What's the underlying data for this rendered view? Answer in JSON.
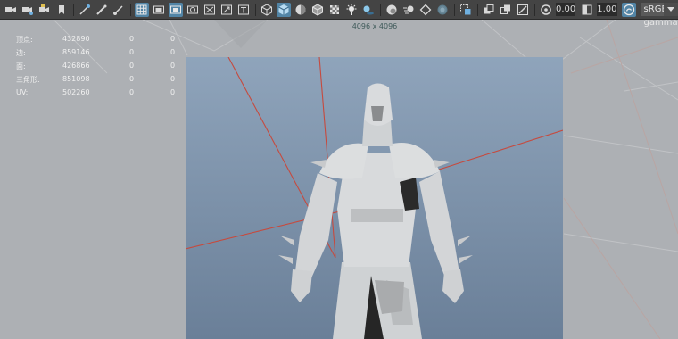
{
  "toolbar": {
    "exposure_value": "0.00",
    "gamma_value": "1.00",
    "color_space": "sRGB gamma",
    "icons": [
      "camera-icon",
      "camera-attributes-icon",
      "bookmark-camera-icon",
      "bookmark-icon",
      "image-plane-icon",
      "grease-pencil-icon",
      "brush-icon",
      "grid-icon",
      "film-gate-icon",
      "resolution-gate-icon",
      "gate-mask-icon",
      "field-chart-icon",
      "safe-action-icon",
      "safe-title-icon",
      "wireframe-icon",
      "smooth-shade-icon",
      "shade-wireframe-icon",
      "wireframe-on-shaded-icon",
      "textured-icon",
      "use-all-lights-icon",
      "shadows-icon",
      "ambient-occlusion-icon",
      "motion-blur-icon",
      "anti-alias-icon",
      "depth-of-field-icon",
      "isolate-select-icon",
      "xray-icon",
      "xray-joints-icon",
      "xray-components-icon",
      "exposure-icon",
      "gamma-icon",
      "color-management-icon"
    ]
  },
  "hud": {
    "rows": [
      {
        "label": "顶点:",
        "v1": "432890",
        "v2": "0",
        "v3": "0"
      },
      {
        "label": "边:",
        "v1": "859146",
        "v2": "0",
        "v3": "0"
      },
      {
        "label": "面:",
        "v1": "426866",
        "v2": "0",
        "v3": "0"
      },
      {
        "label": "三角形:",
        "v1": "851098",
        "v2": "0",
        "v3": "0"
      },
      {
        "label": "UV:",
        "v1": "502260",
        "v2": "0",
        "v3": "0"
      }
    ]
  },
  "viewport": {
    "resolution_label": "4096 x 4096"
  },
  "colors": {
    "toolbar_bg": "#444444",
    "viewport_bg": "#adb0b4",
    "texture_bg_top": "#8fa4bb",
    "texture_bg_bottom": "#6a7f98",
    "accent": "#5285a6",
    "camera_line": "#c8483c"
  }
}
